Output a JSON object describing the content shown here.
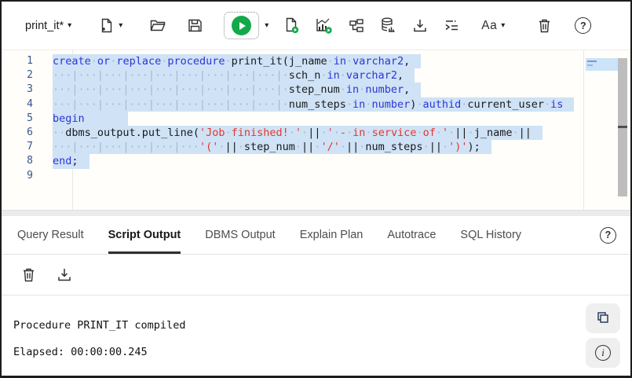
{
  "toolbar": {
    "worksheet_name": "print_it*",
    "text_size_label": "Aa",
    "button_names": [
      "worksheet-dropdown",
      "new-worksheet",
      "open",
      "save",
      "run-statement",
      "run-dropdown",
      "run-script",
      "autotrace",
      "explain-plan",
      "database-statistics",
      "download",
      "format",
      "text-size",
      "clear-worksheet",
      "help"
    ],
    "accent_green": "#12a94a"
  },
  "editor": {
    "selection_color": "#cfe2f6",
    "keyword_color": "#2b36d6",
    "string_color": "#e2382c",
    "lines": [
      {
        "n": 1,
        "sel": true,
        "trail": 14,
        "segs": [
          [
            "kw",
            "create"
          ],
          [
            "ws",
            "·"
          ],
          [
            "kw",
            "or"
          ],
          [
            "ws",
            "·"
          ],
          [
            "kw",
            "replace"
          ],
          [
            "ws",
            "·"
          ],
          [
            "kw",
            "procedure"
          ],
          [
            "ws",
            "·"
          ],
          [
            "id",
            "print_it(j_name"
          ],
          [
            "ws",
            "·"
          ],
          [
            "kw",
            "in"
          ],
          [
            "ws",
            "·"
          ],
          [
            "kw",
            "varchar2"
          ],
          [
            "id",
            ","
          ]
        ]
      },
      {
        "n": 2,
        "sel": true,
        "trail": 14,
        "segs": [
          [
            "ws",
            "···|···|···|···|···|···|···|···|···|·"
          ],
          [
            "id",
            "sch_n"
          ],
          [
            "ws",
            "·"
          ],
          [
            "kw",
            "in"
          ],
          [
            "ws",
            "·"
          ],
          [
            "kw",
            "varchar2"
          ],
          [
            "id",
            ","
          ]
        ]
      },
      {
        "n": 3,
        "sel": true,
        "trail": 14,
        "segs": [
          [
            "ws",
            "···|···|···|···|···|···|···|···|···|·"
          ],
          [
            "id",
            "step_num"
          ],
          [
            "ws",
            "·"
          ],
          [
            "kw",
            "in"
          ],
          [
            "ws",
            "·"
          ],
          [
            "kw",
            "number"
          ],
          [
            "id",
            ","
          ]
        ]
      },
      {
        "n": 4,
        "sel": true,
        "trail": 14,
        "segs": [
          [
            "ws",
            "···|···|···|···|···|···|···|···|···|·"
          ],
          [
            "id",
            "num_steps"
          ],
          [
            "ws",
            "·"
          ],
          [
            "kw",
            "in"
          ],
          [
            "ws",
            "·"
          ],
          [
            "kw",
            "number"
          ],
          [
            "id",
            ")"
          ],
          [
            "ws",
            "·"
          ],
          [
            "kw",
            "authid"
          ],
          [
            "ws",
            "·"
          ],
          [
            "id",
            "current_user"
          ],
          [
            "ws",
            "·"
          ],
          [
            "kw",
            "is"
          ]
        ]
      },
      {
        "n": 5,
        "sel": true,
        "trail": 55,
        "segs": [
          [
            "kw",
            "begin"
          ]
        ]
      },
      {
        "n": 6,
        "sel": true,
        "trail": 14,
        "segs": [
          [
            "ws",
            "··"
          ],
          [
            "id",
            "dbms_output.put_line("
          ],
          [
            "str",
            "'Job"
          ],
          [
            "ws",
            "·"
          ],
          [
            "str",
            "finished!"
          ],
          [
            "ws",
            "·"
          ],
          [
            "str",
            "'"
          ],
          [
            "ws",
            "·"
          ],
          [
            "id",
            "||"
          ],
          [
            "ws",
            "·"
          ],
          [
            "str",
            "'"
          ],
          [
            "ws",
            "·"
          ],
          [
            "str",
            "-"
          ],
          [
            "ws",
            "·"
          ],
          [
            "str",
            "in"
          ],
          [
            "ws",
            "·"
          ],
          [
            "str",
            "service"
          ],
          [
            "ws",
            "·"
          ],
          [
            "str",
            "of"
          ],
          [
            "ws",
            "·"
          ],
          [
            "str",
            "'"
          ],
          [
            "ws",
            "·"
          ],
          [
            "id",
            "||"
          ],
          [
            "ws",
            "·"
          ],
          [
            "id",
            "j_name"
          ],
          [
            "ws",
            "·"
          ],
          [
            "id",
            "||"
          ]
        ]
      },
      {
        "n": 7,
        "sel": true,
        "trail": 14,
        "segs": [
          [
            "ws",
            "···|···|···|···|···|···"
          ],
          [
            "str",
            "'('"
          ],
          [
            "ws",
            "·"
          ],
          [
            "id",
            "||"
          ],
          [
            "ws",
            "·"
          ],
          [
            "id",
            "step_num"
          ],
          [
            "ws",
            "·"
          ],
          [
            "id",
            "||"
          ],
          [
            "ws",
            "·"
          ],
          [
            "str",
            "'/'"
          ],
          [
            "ws",
            "·"
          ],
          [
            "id",
            "||"
          ],
          [
            "ws",
            "·"
          ],
          [
            "id",
            "num_steps"
          ],
          [
            "ws",
            "·"
          ],
          [
            "id",
            "||"
          ],
          [
            "ws",
            "·"
          ],
          [
            "str",
            "')'"
          ],
          [
            "id",
            ");"
          ]
        ]
      },
      {
        "n": 8,
        "sel": true,
        "trail": 14,
        "segs": [
          [
            "kw",
            "end"
          ],
          [
            "id",
            ";"
          ]
        ]
      },
      {
        "n": 9,
        "sel": false,
        "trail": 0,
        "segs": []
      }
    ]
  },
  "tabs": [
    {
      "label": "Query Result",
      "active": false
    },
    {
      "label": "Script Output",
      "active": true
    },
    {
      "label": "DBMS Output",
      "active": false
    },
    {
      "label": "Explain Plan",
      "active": false
    },
    {
      "label": "Autotrace",
      "active": false
    },
    {
      "label": "SQL History",
      "active": false
    }
  ],
  "result_toolbar": {
    "button_names": [
      "clear-output",
      "download-output"
    ]
  },
  "output": {
    "message": "Procedure PRINT_IT compiled",
    "elapsed": "Elapsed: 00:00:00.245",
    "button_names": [
      "copy-output",
      "output-info"
    ]
  },
  "help_glyph": "?"
}
